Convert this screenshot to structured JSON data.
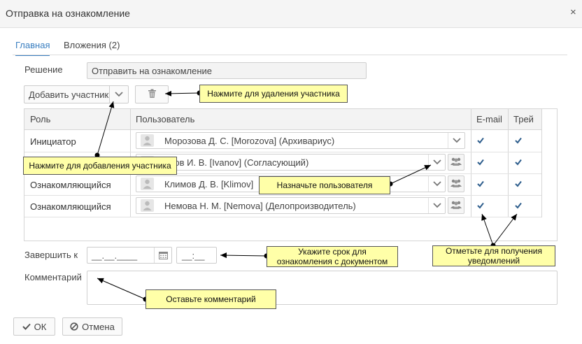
{
  "window": {
    "title": "Отправка на ознакомление",
    "close": "×"
  },
  "tabs": [
    {
      "label": "Главная"
    },
    {
      "label": "Вложения (2)"
    }
  ],
  "form": {
    "decision_label": "Решение",
    "decision_value": "Отправить на ознакомление",
    "add_participant_label": "Добавить участник",
    "finish_label": "Завершить к",
    "date_placeholder": "__.__.____",
    "time_placeholder": "__:__",
    "comment_label": "Комментарий"
  },
  "grid": {
    "columns": [
      "Роль",
      "Пользователь",
      "E-mail",
      "Трей"
    ],
    "rows": [
      {
        "role": "Инициатор",
        "user": "Морозова Д. С. [Morozova] (Архивариус)",
        "email": true,
        "tray": true
      },
      {
        "role": "",
        "user": "анов И. В. [Ivanov] (Согласующий)",
        "email": true,
        "tray": true
      },
      {
        "role": "Ознакомляющийся",
        "user": "Климов Д. В. [Klimov]",
        "email": true,
        "tray": true
      },
      {
        "role": "Ознакомляющийся",
        "user": "Немова Н. М. [Nemova] (Делопроизводитель)",
        "email": true,
        "tray": true
      }
    ]
  },
  "buttons": {
    "ok": "ОК",
    "cancel": "Отмена"
  },
  "callouts": {
    "delete": "Нажмите для удаления участника",
    "add": "Нажмите для добавления участника",
    "assign": "Назначьте пользователя",
    "deadline_line1": "Укажите срок для",
    "deadline_line2": "ознакомления с документом",
    "notify_line1": "Отметьте для получения",
    "notify_line2": "уведомлений",
    "comment": "Оставьте комментарий"
  },
  "colors": {
    "accent": "#3a7fc1",
    "callout_bg": "#ffffa8"
  }
}
